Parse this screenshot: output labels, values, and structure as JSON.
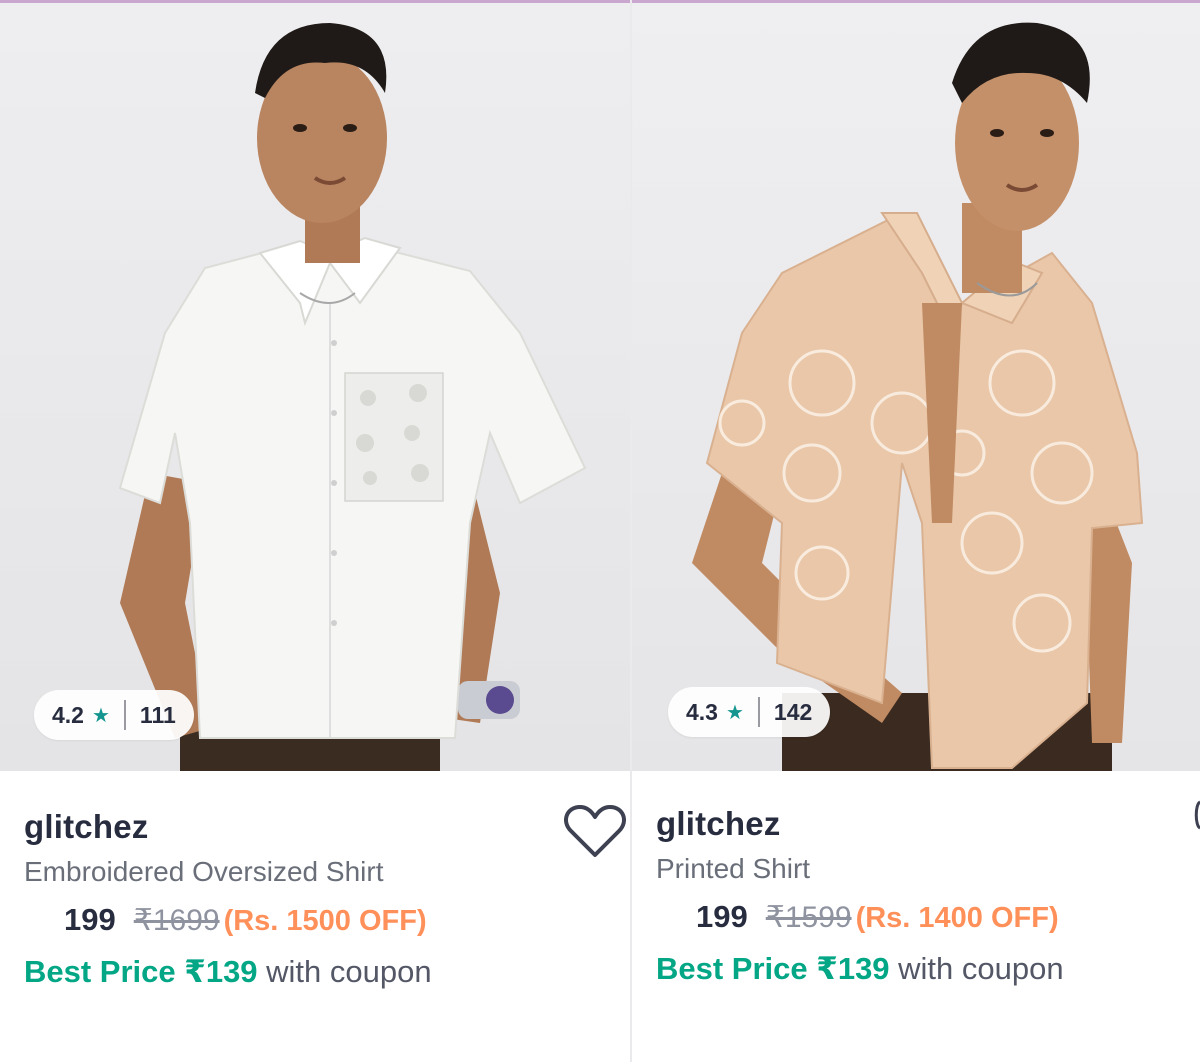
{
  "products": [
    {
      "image_alt": "Man wearing white embroidered oversized short-sleeve shirt",
      "rating": "4.2",
      "star": "★",
      "reviews": "111",
      "brand": "glitchez",
      "name": "Embroidered Oversized Shirt",
      "price": "199",
      "mrp": "₹1699",
      "discount": "(Rs. 1500 OFF)",
      "best_price_label": "Best Price ₹139",
      "best_price_suffix": " with coupon",
      "wishlist_icon": "heart-outline-icon"
    },
    {
      "image_alt": "Man wearing peach printed short-sleeve shirt",
      "rating": "4.3",
      "star": "★",
      "reviews": "142",
      "brand": "glitchez",
      "name": "Printed Shirt",
      "price": "199",
      "mrp": "₹1599",
      "discount": "(Rs. 1400 OFF)",
      "best_price_label": "Best Price ₹139",
      "best_price_suffix": " with coupon",
      "wishlist_icon": "heart-outline-icon"
    }
  ],
  "colors": {
    "best_price": "#03a685",
    "discount": "#ff905a",
    "star": "#14958f",
    "text": "#282c3f",
    "muted": "#696e79"
  }
}
